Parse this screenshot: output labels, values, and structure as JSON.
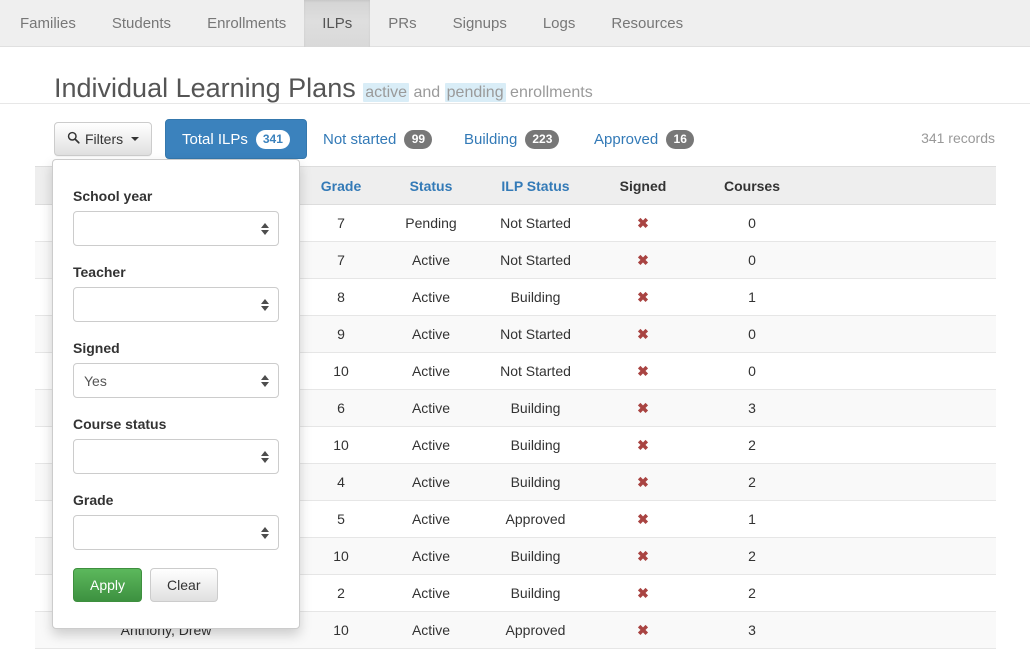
{
  "nav": {
    "items": [
      {
        "label": "Families",
        "active": false
      },
      {
        "label": "Students",
        "active": false
      },
      {
        "label": "Enrollments",
        "active": false
      },
      {
        "label": "ILPs",
        "active": true
      },
      {
        "label": "PRs",
        "active": false
      },
      {
        "label": "Signups",
        "active": false
      },
      {
        "label": "Logs",
        "active": false
      },
      {
        "label": "Resources",
        "active": false
      }
    ]
  },
  "header": {
    "title": "Individual Learning Plans",
    "sub_pre": "",
    "sub_hl1": "active",
    "sub_mid": "and",
    "sub_hl2": "pending",
    "sub_post": "enrollments"
  },
  "toolbar": {
    "filters_label": "Filters",
    "filters_icon": "search-icon",
    "records_label": "341 records",
    "stats": [
      {
        "label": "Total ILPs",
        "count": "341",
        "style": "primary"
      },
      {
        "label": "Not started",
        "count": "99",
        "style": "plain"
      },
      {
        "label": "Building",
        "count": "223",
        "style": "plain"
      },
      {
        "label": "Approved",
        "count": "16",
        "style": "plain"
      }
    ]
  },
  "filter_panel": {
    "fields": [
      {
        "label": "School year",
        "value": ""
      },
      {
        "label": "Teacher",
        "value": ""
      },
      {
        "label": "Signed",
        "value": "Yes"
      },
      {
        "label": "Course status",
        "value": ""
      },
      {
        "label": "Grade",
        "value": ""
      }
    ],
    "apply_label": "Apply",
    "clear_label": "Clear"
  },
  "table": {
    "columns": [
      {
        "key": "name",
        "label": "",
        "sortable": false
      },
      {
        "key": "grade",
        "label": "Grade",
        "sortable": true
      },
      {
        "key": "status",
        "label": "Status",
        "sortable": true
      },
      {
        "key": "ilp",
        "label": "ILP Status",
        "sortable": true
      },
      {
        "key": "signed",
        "label": "Signed",
        "sortable": false
      },
      {
        "key": "courses",
        "label": "Courses",
        "sortable": false
      }
    ],
    "signed_icon": "x-mark-icon",
    "rows": [
      {
        "name": "",
        "grade": "7",
        "status": "Pending",
        "ilp": "Not Started",
        "signed": "✖",
        "courses": "0"
      },
      {
        "name": "",
        "grade": "7",
        "status": "Active",
        "ilp": "Not Started",
        "signed": "✖",
        "courses": "0"
      },
      {
        "name": "",
        "grade": "8",
        "status": "Active",
        "ilp": "Building",
        "signed": "✖",
        "courses": "1"
      },
      {
        "name": "",
        "grade": "9",
        "status": "Active",
        "ilp": "Not Started",
        "signed": "✖",
        "courses": "0"
      },
      {
        "name": "",
        "grade": "10",
        "status": "Active",
        "ilp": "Not Started",
        "signed": "✖",
        "courses": "0"
      },
      {
        "name": "",
        "grade": "6",
        "status": "Active",
        "ilp": "Building",
        "signed": "✖",
        "courses": "3"
      },
      {
        "name": "",
        "grade": "10",
        "status": "Active",
        "ilp": "Building",
        "signed": "✖",
        "courses": "2"
      },
      {
        "name": "",
        "grade": "4",
        "status": "Active",
        "ilp": "Building",
        "signed": "✖",
        "courses": "2"
      },
      {
        "name": "",
        "grade": "5",
        "status": "Active",
        "ilp": "Approved",
        "signed": "✖",
        "courses": "1"
      },
      {
        "name": "",
        "grade": "10",
        "status": "Active",
        "ilp": "Building",
        "signed": "✖",
        "courses": "2"
      },
      {
        "name": "",
        "grade": "2",
        "status": "Active",
        "ilp": "Building",
        "signed": "✖",
        "courses": "2"
      },
      {
        "name": "Anthony, Drew",
        "grade": "10",
        "status": "Active",
        "ilp": "Approved",
        "signed": "✖",
        "courses": "3"
      }
    ]
  },
  "colors": {
    "primary": "#3b82bd",
    "link": "#337ab7",
    "highlight": "#d9edf7",
    "danger": "#a94442",
    "success": "#5cb85c",
    "badge_grey": "#777777"
  }
}
